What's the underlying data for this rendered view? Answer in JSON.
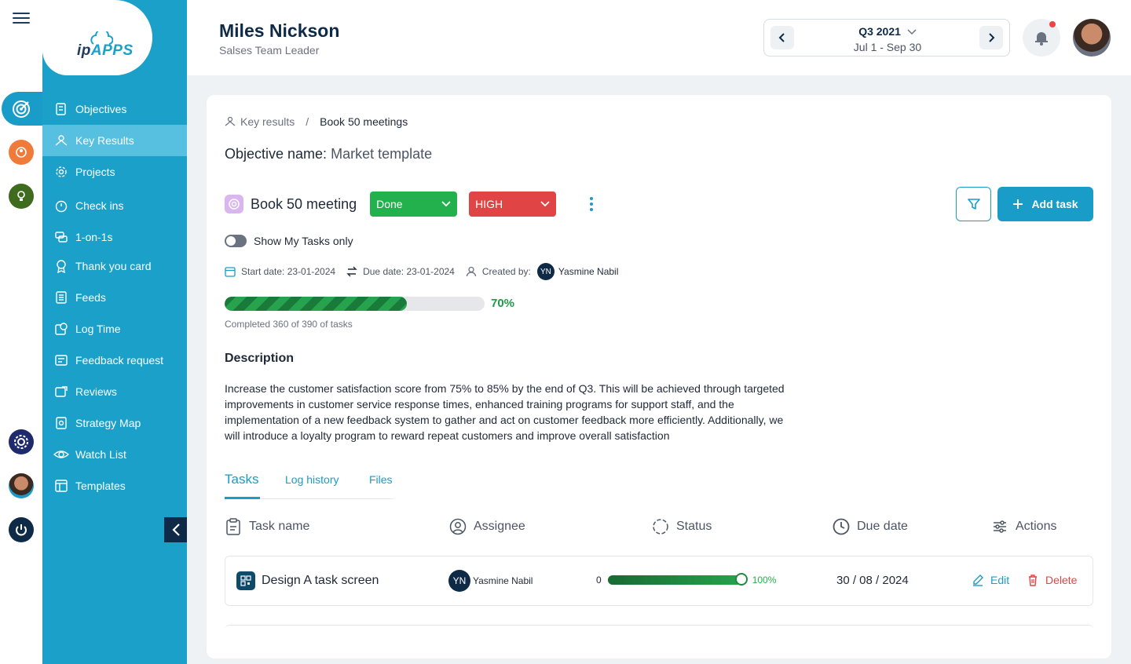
{
  "brand": {
    "logo_text": "APPS",
    "logo_prefix": "ip",
    "accent": "#1aa0c9",
    "dark": "#0e2a47"
  },
  "sidebar": {
    "items": [
      {
        "label": "Objectives",
        "icon": "objectives-icon"
      },
      {
        "label": "Key Results",
        "icon": "key-results-icon",
        "active": true
      },
      {
        "label": "Projects",
        "icon": "projects-icon"
      },
      {
        "label": "Check ins",
        "icon": "check-ins-icon"
      },
      {
        "label": "1-on-1s",
        "icon": "one-on-one-icon"
      },
      {
        "label": "Thank you card",
        "icon": "award-icon"
      },
      {
        "label": "Feeds",
        "icon": "feeds-icon"
      },
      {
        "label": "Log Time",
        "icon": "log-time-icon"
      },
      {
        "label": "Feedback request",
        "icon": "feedback-icon"
      },
      {
        "label": "Reviews",
        "icon": "reviews-icon"
      },
      {
        "label": "Strategy Map",
        "icon": "strategy-map-icon"
      },
      {
        "label": "Watch List",
        "icon": "eye-icon"
      },
      {
        "label": "Templates",
        "icon": "templates-icon"
      }
    ]
  },
  "header": {
    "user_name": "Miles Nickson",
    "user_role": "Salses Team Leader",
    "period": {
      "quarter": "Q3 2021",
      "range": "Jul 1 - Sep 30"
    }
  },
  "breadcrumb": {
    "parent": "Key results",
    "separator": "/",
    "current": "Book 50 meetings"
  },
  "objective": {
    "label": "Objective name:",
    "value": "Market template"
  },
  "key_result": {
    "title": "Book 50 meeting",
    "status": "Done",
    "priority": "HIGH",
    "status_color": "#22b14c",
    "priority_color": "#e04444"
  },
  "actions": {
    "add_task": "Add task"
  },
  "toggle": {
    "label": "Show My Tasks only",
    "on": false
  },
  "meta": {
    "start_date": "Start date: 23-01-2024",
    "due_date": "Due date: 23-01-2024",
    "created_by_label": "Created by:",
    "creator_initials": "YN",
    "creator_name": "Yasmine Nabil"
  },
  "progress": {
    "value": 0.7,
    "label": "70%",
    "completed_text": "Completed 360 of 390 of tasks"
  },
  "description": {
    "heading": "Description",
    "text": "Increase the customer satisfaction score from 75% to 85% by the end of Q3. This will be achieved through targeted improvements in customer service response times, enhanced training programs for support staff, and the implementation of a new feedback system to gather and act on customer feedback more efficiently. Additionally, we will introduce a loyalty program to reward repeat customers and improve overall satisfaction"
  },
  "tabs": [
    {
      "label": "Tasks",
      "active": true
    },
    {
      "label": "Log history"
    },
    {
      "label": "Files"
    }
  ],
  "table": {
    "headers": [
      "Task name",
      "Assignee",
      "Status",
      "Due date",
      "Actions"
    ],
    "rows": [
      {
        "task": "Design A task screen",
        "assignee_initials": "YN",
        "assignee": "Yasmine Nabil",
        "status_min": "0",
        "status_value": 1.0,
        "status_label": "100%",
        "due": "30 / 08 / 2024",
        "edit": "Edit",
        "delete": "Delete"
      }
    ]
  }
}
